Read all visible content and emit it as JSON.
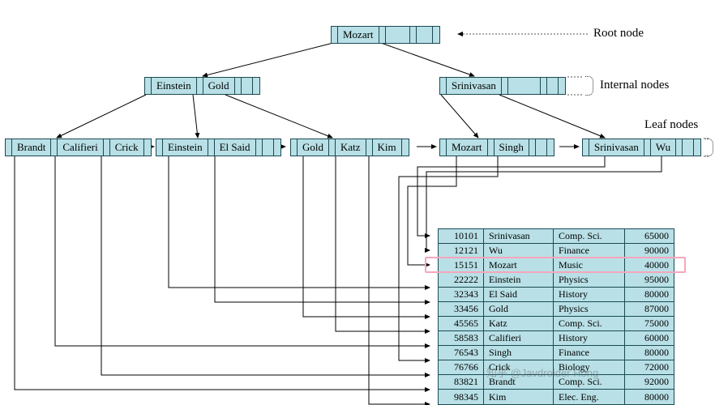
{
  "labels": {
    "root": "Root node",
    "internal": "Internal nodes",
    "leaf": "Leaf nodes"
  },
  "tree": {
    "root": {
      "keys": [
        "Mozart"
      ],
      "slots": 4
    },
    "internal": [
      {
        "keys": [
          "Einstein",
          "Gold"
        ],
        "slots": 4
      },
      {
        "keys": [
          "Srinivasan"
        ],
        "slots": 4
      }
    ],
    "leaves": [
      {
        "keys": [
          "Brandt",
          "Califieri",
          "Crick"
        ],
        "slots": 4
      },
      {
        "keys": [
          "Einstein",
          "El Said"
        ],
        "slots": 4
      },
      {
        "keys": [
          "Gold",
          "Katz",
          "Kim"
        ],
        "slots": 4
      },
      {
        "keys": [
          "Mozart",
          "Singh"
        ],
        "slots": 4
      },
      {
        "keys": [
          "Srinivasan",
          "Wu"
        ],
        "slots": 4
      }
    ]
  },
  "table": {
    "rows": [
      {
        "id": "10101",
        "name": "Srinivasan",
        "dept": "Comp. Sci.",
        "salary": "65000"
      },
      {
        "id": "12121",
        "name": "Wu",
        "dept": "Finance",
        "salary": "90000"
      },
      {
        "id": "15151",
        "name": "Mozart",
        "dept": "Music",
        "salary": "40000"
      },
      {
        "id": "22222",
        "name": "Einstein",
        "dept": "Physics",
        "salary": "95000"
      },
      {
        "id": "32343",
        "name": "El Said",
        "dept": "History",
        "salary": "80000"
      },
      {
        "id": "33456",
        "name": "Gold",
        "dept": "Physics",
        "salary": "87000"
      },
      {
        "id": "45565",
        "name": "Katz",
        "dept": "Comp. Sci.",
        "salary": "75000"
      },
      {
        "id": "58583",
        "name": "Califieri",
        "dept": "History",
        "salary": "60000"
      },
      {
        "id": "76543",
        "name": "Singh",
        "dept": "Finance",
        "salary": "80000"
      },
      {
        "id": "76766",
        "name": "Crick",
        "dept": "Biology",
        "salary": "72000"
      },
      {
        "id": "83821",
        "name": "Brandt",
        "dept": "Comp. Sci.",
        "salary": "92000"
      },
      {
        "id": "98345",
        "name": "Kim",
        "dept": "Elec. Eng.",
        "salary": "80000"
      }
    ],
    "highlight_row_index": 2
  },
  "watermark": "知乎 @Javdroider Hong"
}
